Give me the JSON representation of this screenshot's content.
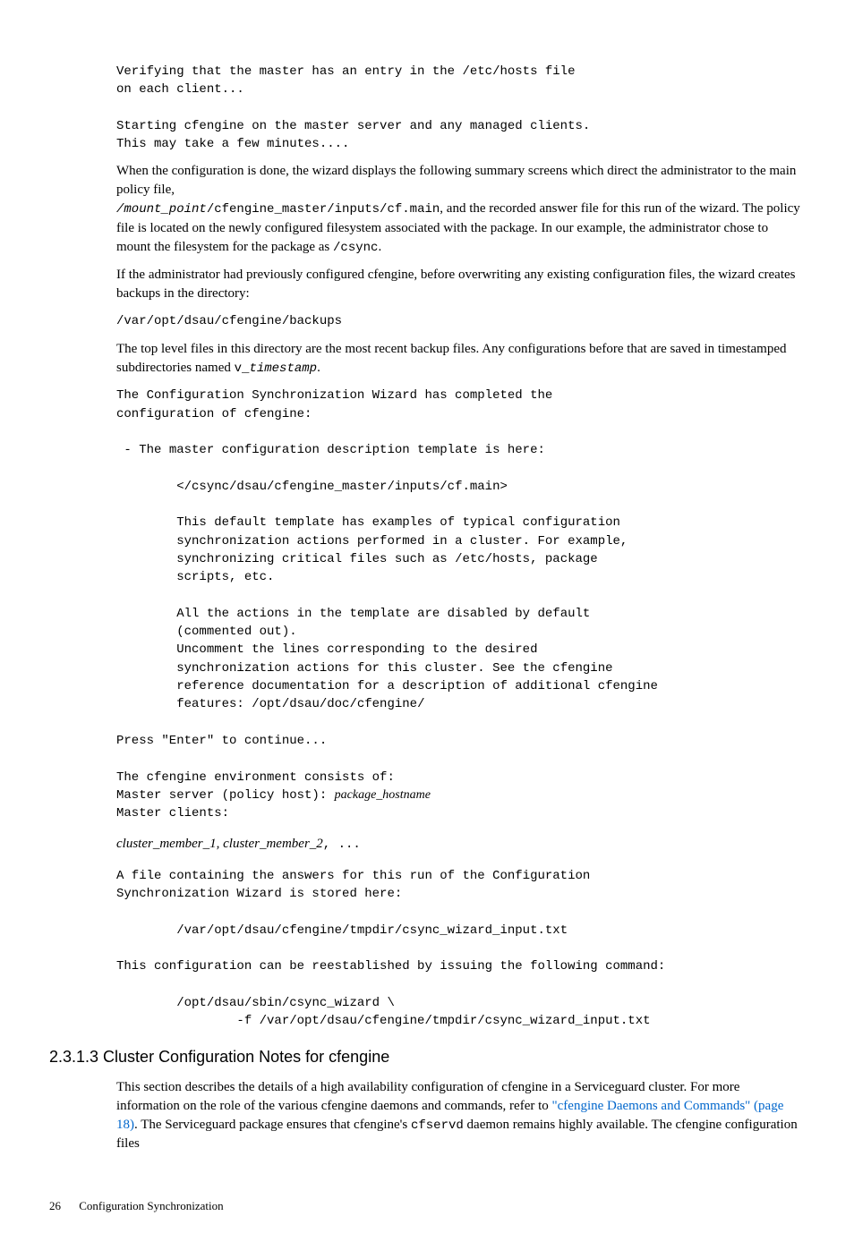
{
  "code1": "Verifying that the master has an entry in the /etc/hosts file\non each client...\n\nStarting cfengine on the master server and any managed clients.\nThis may take a few minutes....",
  "para1_a": "When the configuration is done, the wizard displays the following summary screens which direct the administrator to the main policy file,",
  "para1_b_mono_italic": "/mount_point",
  "para1_b_mono": "/cfengine_master/inputs/cf.main",
  "para1_c": ", and the recorded answer file for this run of the wizard. The policy file is located on the newly configured filesystem associated with the package. In our example, the administrator chose to mount the filesystem for the package as ",
  "para1_d_mono": "/csync",
  "para1_e": ".",
  "para2": "If the administrator had previously configured cfengine,  before overwriting any existing configuration files, the wizard creates backups in the directory:",
  "code2": "/var/opt/dsau/cfengine/backups",
  "para3_a": "The top level files in this directory are the most recent backup files. Any configurations before that are saved in timestamped subdirectories named ",
  "para3_b_mono": "v_",
  "para3_c_mono_italic": "timestamp",
  "para3_d": ".",
  "code3": "The Configuration Synchronization Wizard has completed the\nconfiguration of cfengine:\n\n - The master configuration description template is here:\n\n        </csync/dsau/cfengine_master/inputs/cf.main>\n\n        This default template has examples of typical configuration\n        synchronization actions performed in a cluster. For example,\n        synchronizing critical files such as /etc/hosts, package\n        scripts, etc.\n\n        All the actions in the template are disabled by default\n        (commented out).\n        Uncomment the lines corresponding to the desired\n        synchronization actions for this cluster. See the cfengine\n        reference documentation for a description of additional cfengine\n        features: /opt/dsau/doc/cfengine/\n\nPress \"Enter\" to continue...\n\nThe cfengine environment consists of:",
  "code3_host_prefix": "Master server (policy host): ",
  "code3_host_italic": "package_hostname",
  "code3_clients": "Master clients:",
  "members_italic": "cluster_member_1,  cluster_member_2",
  "members_rest": ", ...",
  "code4": "A file containing the answers for this run of the Configuration\nSynchronization Wizard is stored here:\n\n        /var/opt/dsau/cfengine/tmpdir/csync_wizard_input.txt\n\nThis configuration can be reestablished by issuing the following command:\n\n        /opt/dsau/sbin/csync_wizard \\\n                -f /var/opt/dsau/cfengine/tmpdir/csync_wizard_input.txt",
  "heading": "2.3.1.3 Cluster Configuration Notes for cfengine",
  "para4_a": "This section describes the details of a high availability configuration of cfengine in a Serviceguard cluster. For more information on the role of the various cfengine daemons and commands, refer to ",
  "para4_link": "\"cfengine Daemons and Commands\" (page 18)",
  "para4_b": ". The Serviceguard package ensures that cfengine's ",
  "para4_mono": "cfservd",
  "para4_c": " daemon remains highly available. The cfengine configuration files",
  "footer_page": "26",
  "footer_text": "Configuration Synchronization"
}
